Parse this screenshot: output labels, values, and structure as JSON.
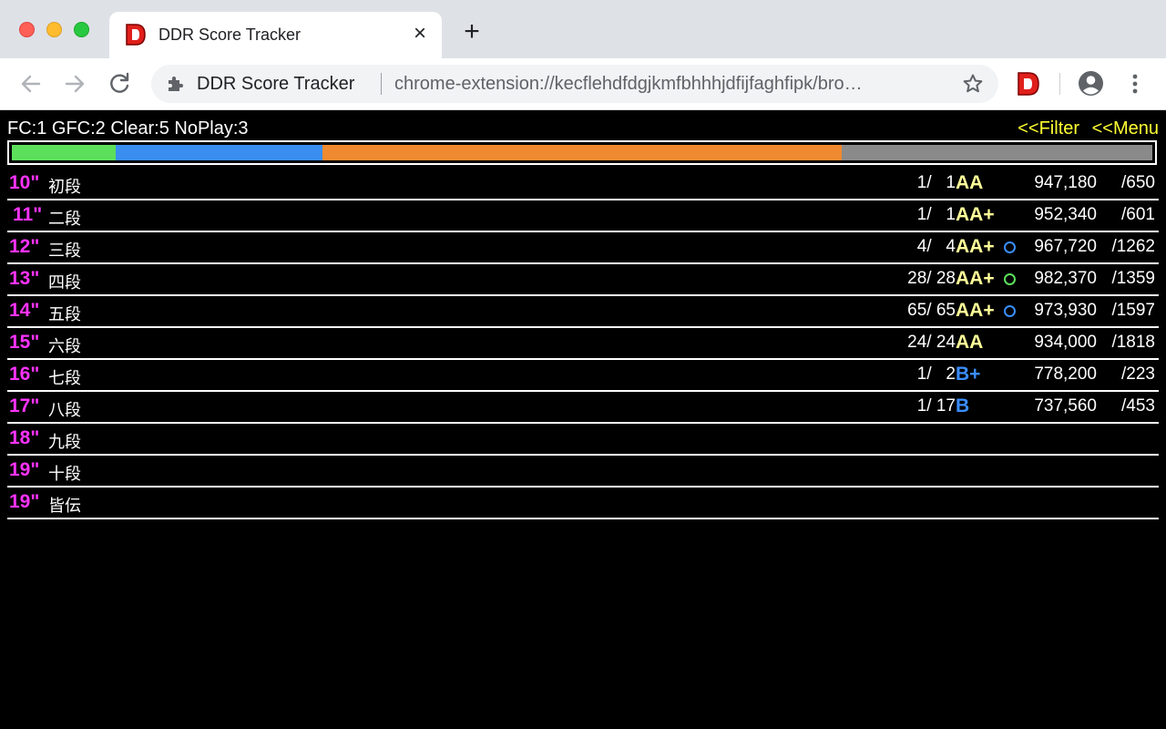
{
  "browser": {
    "tab_title": "DDR Score Tracker",
    "omnibox_name": "DDR Score Tracker",
    "omnibox_url": "chrome-extension://kecflehdfdgjkmfbhhhjdfijfaghfipk/bro…",
    "favicon_letter": "D",
    "favicon_color": "#e0201b"
  },
  "summary": {
    "text": "FC:1 GFC:2 Clear:5 NoPlay:3"
  },
  "links": {
    "filter": "<<Filter",
    "menu": "<<Menu"
  },
  "progress": {
    "segments": [
      {
        "name": "FC",
        "count": 1,
        "color": "#5ce05c"
      },
      {
        "name": "GFC",
        "count": 2,
        "color": "#3a8ef0"
      },
      {
        "name": "Clear",
        "count": 5,
        "color": "#f08a30"
      },
      {
        "name": "NoPlay",
        "count": 3,
        "color": "#8a8a8a"
      }
    ]
  },
  "rows": [
    {
      "level": "10\"",
      "dan": "初段",
      "count": "1/   1",
      "grade": "AA",
      "grade_color": "#ffff99",
      "lamp": "",
      "score": "947,180",
      "rank": "/650"
    },
    {
      "level": "11\"",
      "dan": "二段",
      "count": "1/   1",
      "grade": "AA+",
      "grade_color": "#ffff99",
      "lamp": "",
      "score": "952,340",
      "rank": "/601"
    },
    {
      "level": "12\"",
      "dan": "三段",
      "count": "4/   4",
      "grade": "AA+",
      "grade_color": "#ffff99",
      "lamp": "#3a8eff",
      "score": "967,720",
      "rank": "/1262"
    },
    {
      "level": "13\"",
      "dan": "四段",
      "count": "28/ 28",
      "grade": "AA+",
      "grade_color": "#ffff99",
      "lamp": "#5ce05c",
      "score": "982,370",
      "rank": "/1359"
    },
    {
      "level": "14\"",
      "dan": "五段",
      "count": "65/ 65",
      "grade": "AA+",
      "grade_color": "#ffff99",
      "lamp": "#3a8eff",
      "score": "973,930",
      "rank": "/1597"
    },
    {
      "level": "15\"",
      "dan": "六段",
      "count": "24/ 24",
      "grade": "AA",
      "grade_color": "#ffff99",
      "lamp": "",
      "score": "934,000",
      "rank": "/1818"
    },
    {
      "level": "16\"",
      "dan": "七段",
      "count": "1/   2",
      "grade": "B+",
      "grade_color": "#3a8eff",
      "lamp": "",
      "score": "778,200",
      "rank": "/223"
    },
    {
      "level": "17\"",
      "dan": "八段",
      "count": "1/ 17",
      "grade": "B",
      "grade_color": "#3a8eff",
      "lamp": "",
      "score": "737,560",
      "rank": "/453"
    },
    {
      "level": "18\"",
      "dan": "九段",
      "count": "",
      "grade": "",
      "grade_color": "",
      "lamp": "",
      "score": "",
      "rank": ""
    },
    {
      "level": "19\"",
      "dan": "十段",
      "count": "",
      "grade": "",
      "grade_color": "",
      "lamp": "",
      "score": "",
      "rank": ""
    },
    {
      "level": "19\"",
      "dan": "皆伝",
      "count": "",
      "grade": "",
      "grade_color": "",
      "lamp": "",
      "score": "",
      "rank": ""
    }
  ]
}
